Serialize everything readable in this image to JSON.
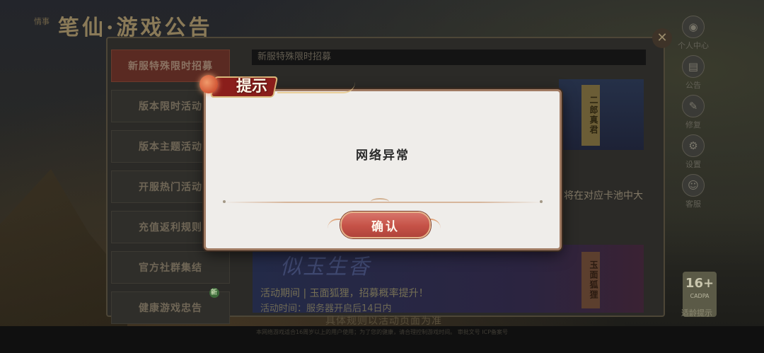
{
  "background": {
    "header_title": "笔仙·游戏公告",
    "header_tag": "情事",
    "sidebar": {
      "items": [
        {
          "label": "新服特殊限时招募",
          "active": true
        },
        {
          "label": "版本限时活动"
        },
        {
          "label": "版本主题活动"
        },
        {
          "label": "开服热门活动"
        },
        {
          "label": "充值返利规则"
        },
        {
          "label": "官方社群集结"
        },
        {
          "label": "健康游戏忠告",
          "badge": "新"
        }
      ]
    },
    "content": {
      "title_bar": "新服特殊限时招募",
      "banner1_badge": "二郎真君",
      "side_text": "将在对应卡池中大",
      "banner2_logo": "似玉生香",
      "banner2_line1": "活动期间 | 玉面狐狸，招募概率提升！",
      "banner2_line2": "活动时间：服务器开启后14日内",
      "banner2_badge": "玉面狐狸",
      "footer_note": "具体规则以活动页面为准"
    },
    "right_nav": [
      {
        "label": "个人中心",
        "icon": "person-icon"
      },
      {
        "label": "公告",
        "icon": "notice-icon"
      },
      {
        "label": "修复",
        "icon": "repair-icon"
      },
      {
        "label": "设置",
        "icon": "gear-icon"
      },
      {
        "label": "客服",
        "icon": "chat-icon"
      }
    ],
    "age_rating": {
      "value": "16+",
      "sub": "CADPA",
      "label": "适龄提示"
    },
    "footer_text": "本网络游戏适合16周岁以上的用户使用；为了您的健康，请合理控制游戏时间。 审批文号 ICP备案号"
  },
  "dialog": {
    "title": "提示",
    "message": "网络异常",
    "confirm_label": "确认"
  },
  "colors": {
    "dialog_bg": "#efedea",
    "confirm_button": "#c55247",
    "title_tab": "#8a1e1b"
  }
}
